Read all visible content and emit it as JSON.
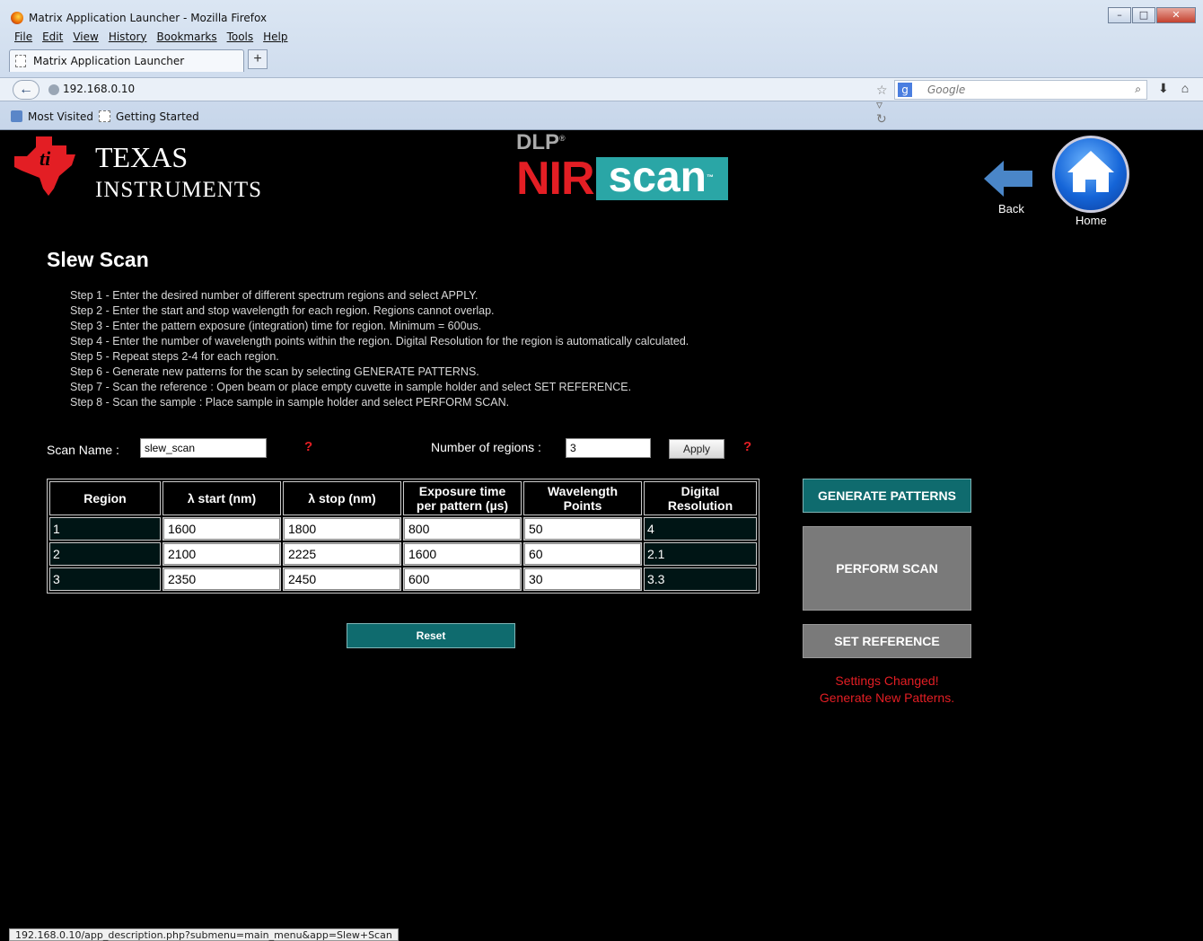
{
  "browser": {
    "window_title": "Matrix Application Launcher - Mozilla Firefox",
    "menu": [
      "File",
      "Edit",
      "View",
      "History",
      "Bookmarks",
      "Tools",
      "Help"
    ],
    "tab_title": "Matrix Application Launcher",
    "new_tab": "+",
    "url": "192.168.0.10",
    "search_engine_label": "Google",
    "bookmarks": [
      "Most Visited",
      "Getting Started"
    ],
    "status_url": "192.168.0.10/app_description.php?submenu=main_menu&app=Slew+Scan"
  },
  "header": {
    "brand_line1": "Texas",
    "brand_line2": "Instruments",
    "product_dlp": "DLP",
    "product_nir": "NIR",
    "product_scan": "scan",
    "back_label": "Back",
    "home_label": "Home"
  },
  "page": {
    "title": "Slew Scan",
    "steps": [
      "Step 1 - Enter the desired number of different spectrum regions and select APPLY.",
      "Step 2 - Enter the start and stop wavelength for each region. Regions cannot overlap.",
      "Step 3 - Enter the pattern exposure (integration) time for region. Minimum = 600us.",
      "Step 4 - Enter the number of wavelength points within the region. Digital Resolution for the region is automatically calculated.",
      "Step 5 - Repeat steps 2-4 for each region.",
      "Step 6 - Generate new patterns for the scan by selecting GENERATE PATTERNS.",
      "Step 7 - Scan the reference : Open beam or place empty cuvette in sample holder and select SET REFERENCE.",
      "Step 8 - Scan the sample : Place sample in sample holder and select PERFORM SCAN."
    ],
    "scan_name_label": "Scan Name :",
    "scan_name_value": "slew_scan",
    "help_mark": "?",
    "regions_label": "Number of regions :",
    "regions_value": "3",
    "apply_label": "Apply",
    "table": {
      "headers": [
        "Region",
        "λ start (nm)",
        "λ stop (nm)",
        "Exposure time per pattern (µs)",
        "Wavelength Points",
        "Digital Resolution"
      ],
      "rows": [
        {
          "region": "1",
          "start": "1600",
          "stop": "1800",
          "exposure": "800",
          "points": "50",
          "resolution": "4"
        },
        {
          "region": "2",
          "start": "2100",
          "stop": "2225",
          "exposure": "1600",
          "points": "60",
          "resolution": "2.1"
        },
        {
          "region": "3",
          "start": "2350",
          "stop": "2450",
          "exposure": "600",
          "points": "30",
          "resolution": "3.3"
        }
      ]
    },
    "reset_label": "Reset",
    "generate_label": "GENERATE PATTERNS",
    "perform_label": "PERFORM SCAN",
    "set_reference_label": "SET REFERENCE",
    "warning_line1": "Settings Changed!",
    "warning_line2": "Generate New Patterns."
  },
  "colors": {
    "accent_teal": "#0f6b6e",
    "warning_red": "#e31e24",
    "disabled_gray": "#7a7a7a"
  }
}
